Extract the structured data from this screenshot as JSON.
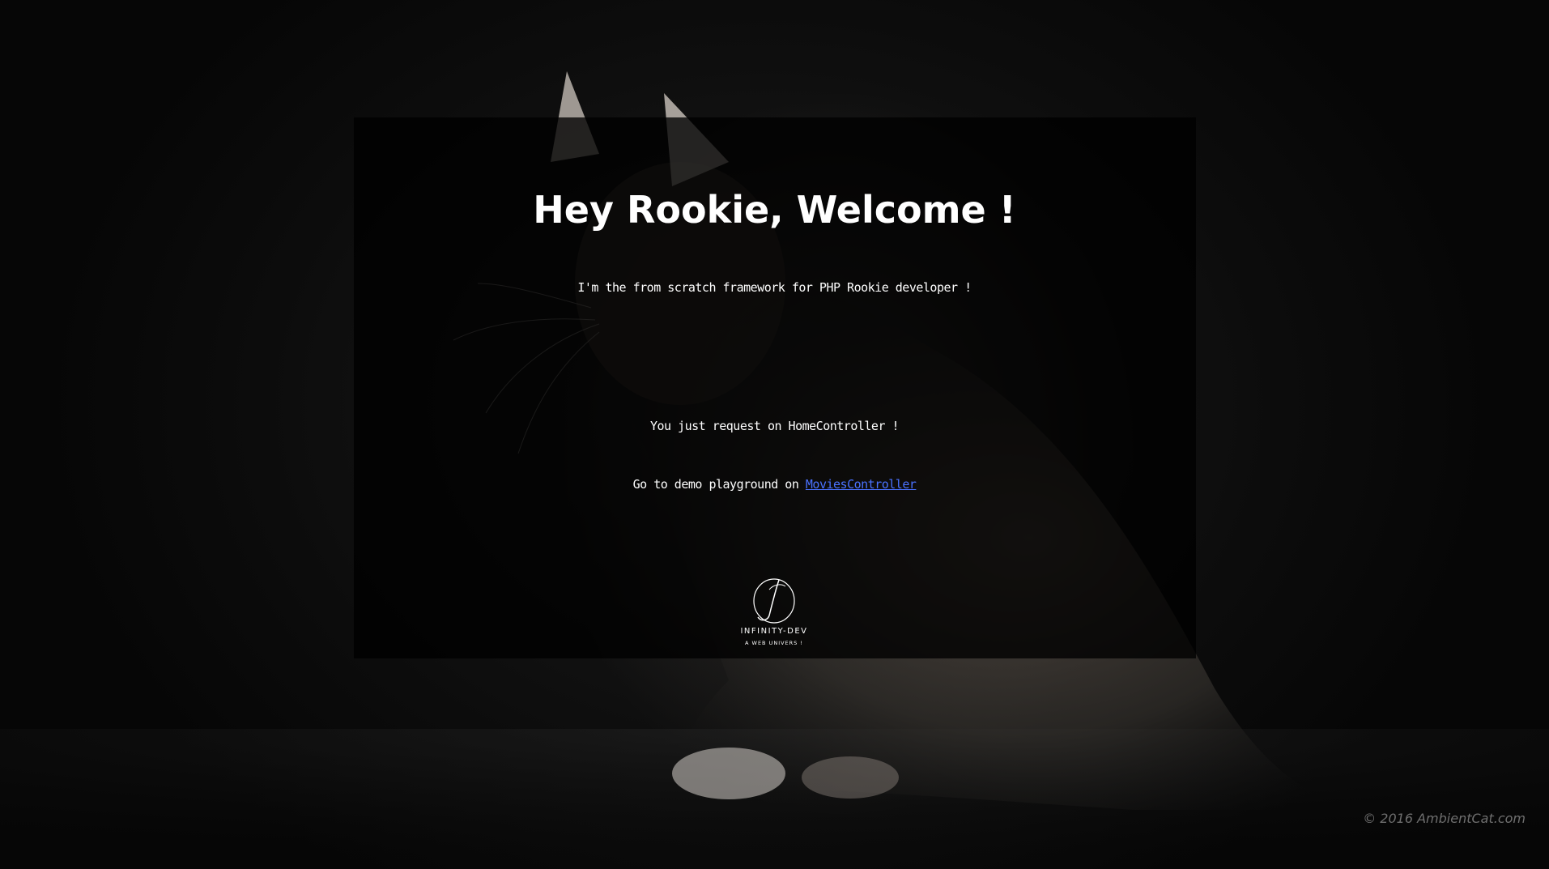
{
  "header": {
    "title": "Hey Rookie, Welcome !",
    "tagline": "I'm the from scratch framework for PHP Rookie developer !"
  },
  "main": {
    "request_text": "You just request on HomeController !",
    "demo_prefix": "Go to demo playground on ",
    "demo_link": "MoviesController"
  },
  "logo": {
    "name": "INFINITY-DEV",
    "subtitle": "A WEB UNIVERS !"
  },
  "footer": {
    "copyright": "© 2016 AmbientCat.com"
  },
  "colors": {
    "link": "#4a72ff",
    "text": "#ffffff",
    "copyright": "#6f6f6f"
  },
  "icons": {
    "logo": "infinity-dev-logo-icon"
  }
}
